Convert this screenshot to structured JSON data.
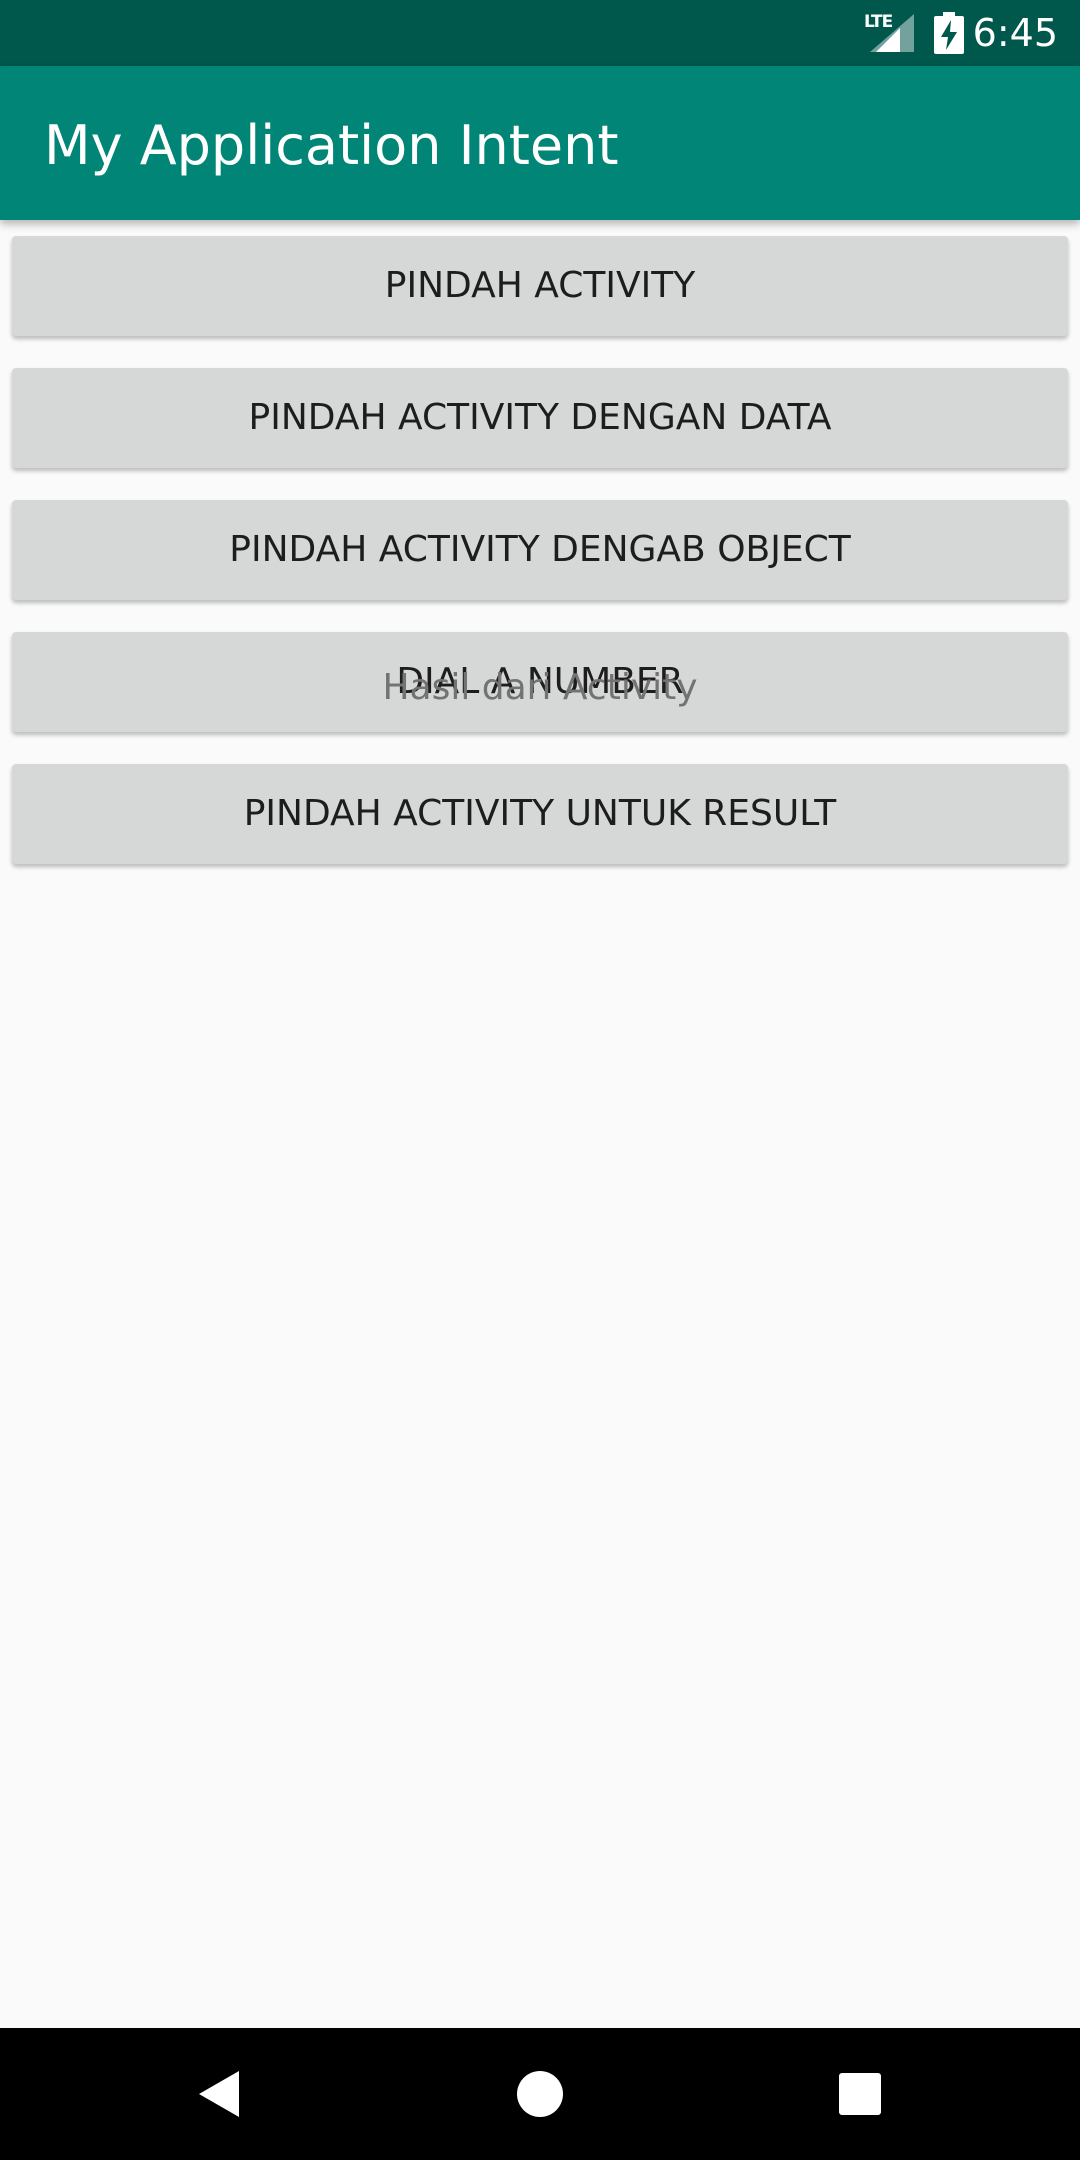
{
  "status_bar": {
    "network": "LTE",
    "time": "6:45",
    "icons": [
      "signal-icon",
      "battery-charging-icon"
    ]
  },
  "app_bar": {
    "title": "My Application Intent"
  },
  "buttons": [
    "PINDAH ACTIVITY",
    "PINDAH ACTIVITY DENGAN DATA",
    "PINDAH ACTIVITY DENGAB OBJECT",
    "DIAL A NUMBER",
    "PINDAH ACTIVITY UNTUK RESULT"
  ],
  "result": {
    "text": "Hasil dari Activity"
  },
  "nav_bar": {
    "icons": [
      "back-icon",
      "home-icon",
      "recents-icon"
    ]
  },
  "colors": {
    "status_bar": "#00574b",
    "app_bar": "#008577",
    "button": "#d6d7d7",
    "background": "#fafafa"
  }
}
